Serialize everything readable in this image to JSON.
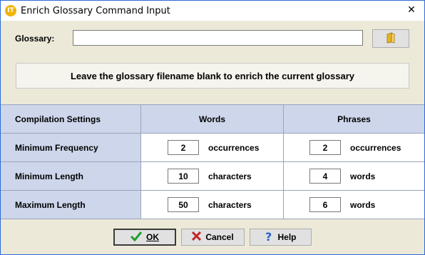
{
  "window": {
    "title": "Enrich Glossary Command Input",
    "app_icon_text": "IT",
    "close_symbol": "✕"
  },
  "glossary": {
    "label": "Glossary:",
    "value": "",
    "browse_icon": "folder-icon"
  },
  "info": {
    "message": "Leave the glossary filename blank to enrich the current glossary"
  },
  "settings": {
    "headers": [
      "Compilation Settings",
      "Words",
      "Phrases"
    ],
    "rows": [
      {
        "label": "Minimum Frequency",
        "words_value": "2",
        "words_unit": "occurrences",
        "phrases_value": "2",
        "phrases_unit": "occurrences"
      },
      {
        "label": "Minimum Length",
        "words_value": "10",
        "words_unit": "characters",
        "phrases_value": "4",
        "phrases_unit": "words"
      },
      {
        "label": "Maximum Length",
        "words_value": "50",
        "words_unit": "characters",
        "phrases_value": "6",
        "phrases_unit": "words"
      }
    ]
  },
  "buttons": {
    "ok_label": "OK",
    "cancel_label": "Cancel",
    "help_label": "Help"
  },
  "colors": {
    "header_bg": "#cdd6ea",
    "dialog_bg": "#ece9d8",
    "ok_icon": "#1f9d2b",
    "cancel_icon": "#c0282c",
    "help_icon": "#2a63c8"
  }
}
